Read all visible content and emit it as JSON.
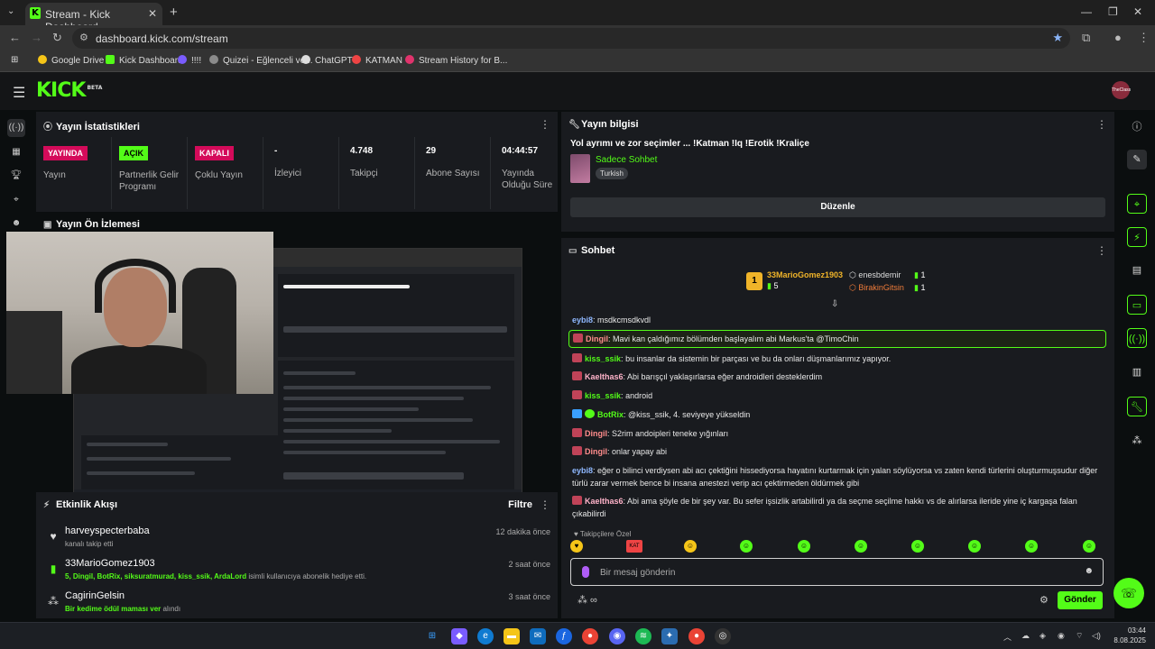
{
  "browser": {
    "tab_title": "Stream - Kick Dashboard",
    "favicon_letter": "K",
    "url": "dashboard.kick.com/stream",
    "bookmarks": [
      "Google Drive",
      "Kick Dashboard",
      "!!!!",
      "Quizei - Eğlenceli ve...",
      "ChatGPT",
      "KATMAN",
      "Stream History for B..."
    ]
  },
  "header": {
    "logo": "KICK",
    "logo_badge": "BETA",
    "avatar_text": "TheClass"
  },
  "stats": {
    "title": "Yayın İstatistikleri",
    "items": [
      {
        "badge": "YAYINDA",
        "label": "Yayın"
      },
      {
        "badge": "AÇIK",
        "label": "Partnerlik Gelir Programı"
      },
      {
        "badge": "KAPALI",
        "label": "Çoklu Yayın"
      },
      {
        "value": "-",
        "label": "İzleyici"
      },
      {
        "value": "4.748",
        "label": "Takipçi"
      },
      {
        "value": "29",
        "label": "Abone Sayısı"
      },
      {
        "value": "04:44:57",
        "label": "Yayında Olduğu Süre"
      }
    ]
  },
  "preview": {
    "title": "Yayın Ön İzlemesi"
  },
  "events": {
    "title": "Etkinlik Akışı",
    "filter": "Filtre",
    "items": [
      {
        "name": "harveyspecterbaba",
        "sub": "kanalı takip etti",
        "time": "12 dakika önce"
      },
      {
        "name": "33MarioGomez1903",
        "sub_users": "5, Dingil, BotRix, siksuratmurad, kiss_ssik, ArdaLord",
        "sub_rest": " isimli kullanıcıya abonelik hediye etti.",
        "time": "2 saat önce"
      },
      {
        "name": "CagirinGelsin",
        "sub_users": "Bir kedime ödül maması ver",
        "sub_rest": " alındı",
        "time": "3 saat önce"
      }
    ]
  },
  "stream_info": {
    "title": "Yayın bilgisi",
    "stream_title": "Yol ayrımı ve zor seçimler ... !Katman !Iq !Erotik !Kraliçe",
    "category": "Sadece Sohbet",
    "language": "Turkish",
    "edit_button": "Düzenle"
  },
  "chat": {
    "title": "Sohbet",
    "top_gifters": [
      {
        "rank": "1",
        "name": "33MarioGomez1903",
        "count": "5"
      },
      {
        "name": "enesbdemir",
        "count": "1"
      },
      {
        "name": "BirakinGitsin",
        "count": "1"
      }
    ],
    "messages": [
      {
        "user": "eybi8",
        "color": "#8fb8ff",
        "text": "msdkcmsdkvdl",
        "badge": ""
      },
      {
        "user": "Dingil",
        "color": "#ff8c8c",
        "text": "Mavi kan çaldığımız bölümden başlayalım abi Markus'ta @TimoChin",
        "badge": "red",
        "highlight": true
      },
      {
        "user": "kiss_ssik",
        "color": "#53fc18",
        "text": "bu insanlar da sistemin bir parçası ve bu da onları düşmanlarımız yapıyor.",
        "badge": "red"
      },
      {
        "user": "Kaelthas6",
        "color": "#ffb3c9",
        "text": "Abi barışçıl yaklaşırlarsa eğer androidleri desteklerdim",
        "badge": "red"
      },
      {
        "user": "kiss_ssik",
        "color": "#53fc18",
        "text": "android",
        "badge": "red"
      },
      {
        "user": "BotRix",
        "color": "#53fc18",
        "text": "@kiss_ssik, 4. seviyeye yükseldin",
        "badge": "bot"
      },
      {
        "user": "Dingil",
        "color": "#ff8c8c",
        "text": "S2rim andoipleri teneke yığınları",
        "badge": "red"
      },
      {
        "user": "Dingil",
        "color": "#ff8c8c",
        "text": "onlar yapay abi",
        "badge": "red"
      },
      {
        "user": "eybi8",
        "color": "#8fb8ff",
        "text": "eğer o bilinci verdiysen abi acı çektiğini hissediyorsa hayatını kurtarmak için yalan söylüyorsa vs zaten kendi türlerini oluşturmuşsudur diğer türlü zarar vermek bence bi insana anestezi verip acı çektirmeden öldürmek gibi",
        "badge": ""
      },
      {
        "user": "Kaelthas6",
        "color": "#ffb3c9",
        "text": "Abi ama şöyle de bir şey var. Bu sefer işsizlik artabilirdi ya da seçme seçilme hakkı vs de alırlarsa ileride yine iç kargaşa falan çıkabilirdi",
        "badge": "red"
      }
    ],
    "followers_only": "Takipçilere Özel",
    "input_placeholder": "Bir mesaj gönderin",
    "send_button": "Gönder"
  },
  "taskbar": {
    "time": "03:44",
    "date": "8.08.2025"
  }
}
